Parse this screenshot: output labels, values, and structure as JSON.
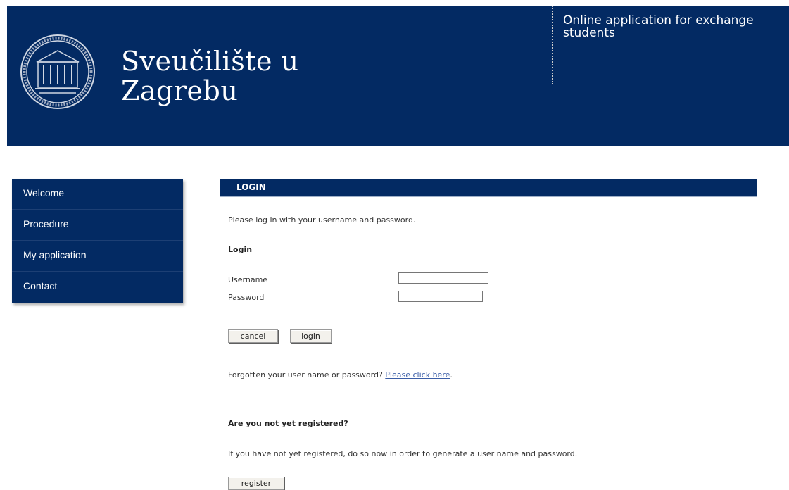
{
  "header": {
    "university_name": "Sveučilište u\nZagrebu",
    "tagline_line1": "Online application for exchange",
    "tagline_line2": "students",
    "seal_icon": "university-seal-icon"
  },
  "sidebar": {
    "items": [
      {
        "label": "Welcome"
      },
      {
        "label": "Procedure"
      },
      {
        "label": "My application"
      },
      {
        "label": "Contact"
      }
    ]
  },
  "login": {
    "section_title": "LOGIN",
    "intro": "Please log in with your username and password.",
    "heading": "Login",
    "username_label": "Username",
    "username_value": "",
    "password_label": "Password",
    "password_value": "",
    "cancel_label": "cancel",
    "login_label": "login",
    "forgot_text": "Forgotten your user name or password?",
    "forgot_link": "Please click here",
    "forgot_suffix": "."
  },
  "register": {
    "heading": "Are you not yet registered?",
    "text": "If you have not yet registered, do so now in order to generate a user name and password.",
    "button_label": "register"
  },
  "colors": {
    "brand_navy": "#032a63",
    "link": "#3b5ea7"
  }
}
